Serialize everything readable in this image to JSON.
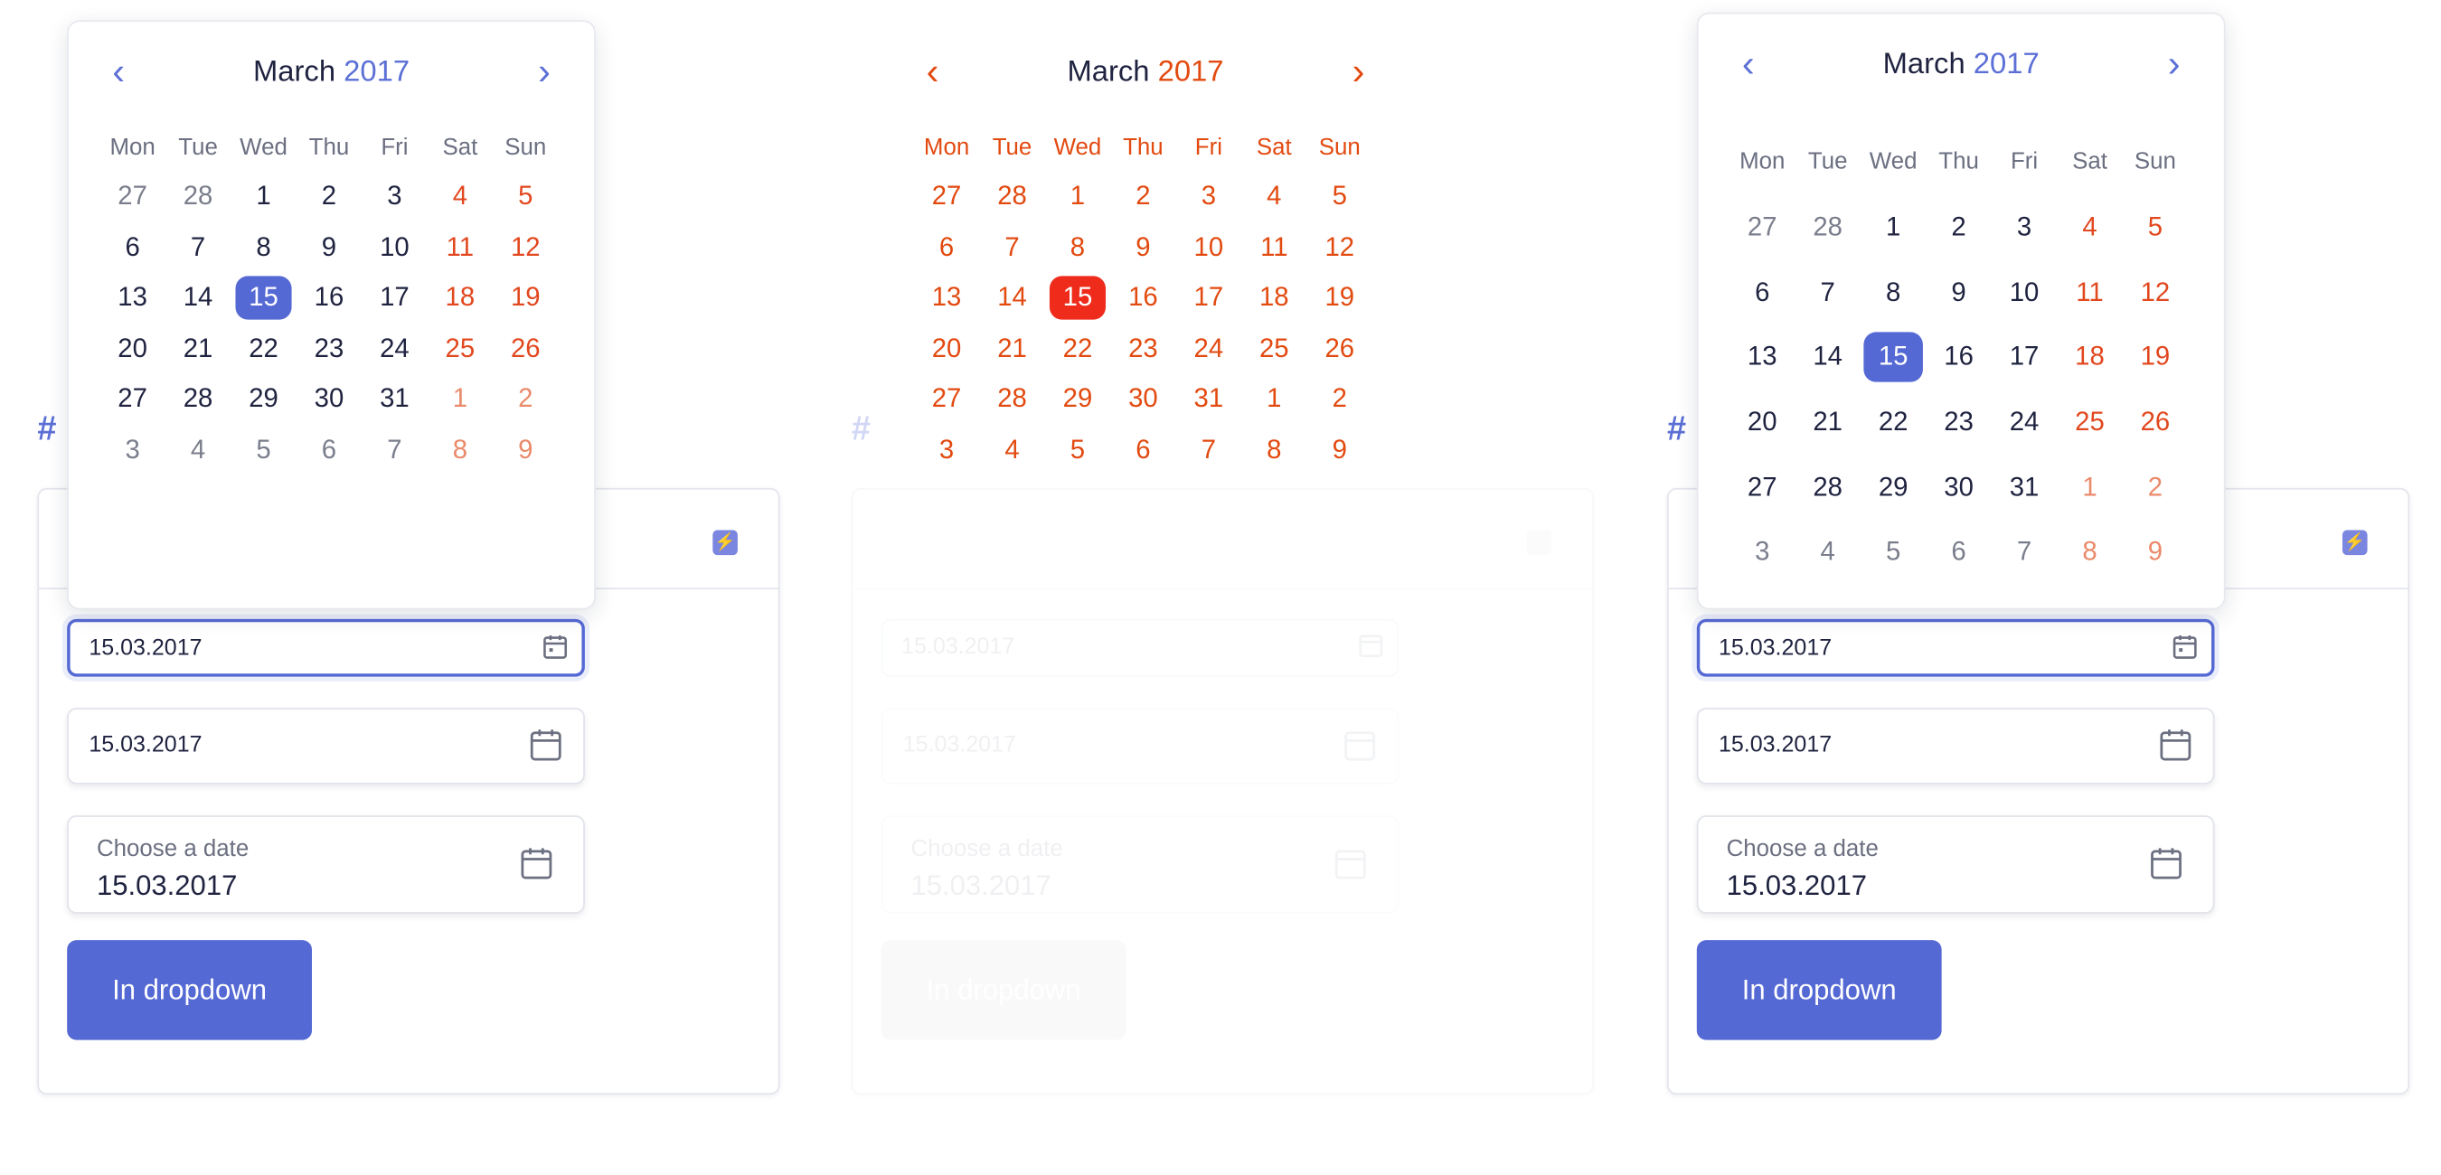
{
  "calendar": {
    "month": "March",
    "year": "2017",
    "weekdays": [
      "Mon",
      "Tue",
      "Wed",
      "Thu",
      "Fri",
      "Sat",
      "Sun"
    ],
    "weeks": [
      [
        "27",
        "28",
        "1",
        "2",
        "3",
        "4",
        "5"
      ],
      [
        "6",
        "7",
        "8",
        "9",
        "10",
        "11",
        "12"
      ],
      [
        "13",
        "14",
        "15",
        "16",
        "17",
        "18",
        "19"
      ],
      [
        "20",
        "21",
        "22",
        "23",
        "24",
        "25",
        "26"
      ],
      [
        "27",
        "28",
        "29",
        "30",
        "31",
        "1",
        "2"
      ],
      [
        "3",
        "4",
        "5",
        "6",
        "7",
        "8",
        "9"
      ]
    ],
    "selected_day": "15",
    "prev_icon": "chevron-left-icon",
    "next_icon": "chevron-right-icon"
  },
  "section_marker": "#",
  "form": {
    "field1_value": "15.03.2017",
    "field2_value": "15.03.2017",
    "field3_label": "Choose a date",
    "field3_value": "15.03.2017",
    "button_label": "In dropdown",
    "header_icon": "bolt-icon",
    "field_icon": "calendar-icon"
  },
  "colors": {
    "accent": "#5569d4",
    "weekend": "#e2481f",
    "text": "#1f2340",
    "muted": "#6b6f80"
  }
}
